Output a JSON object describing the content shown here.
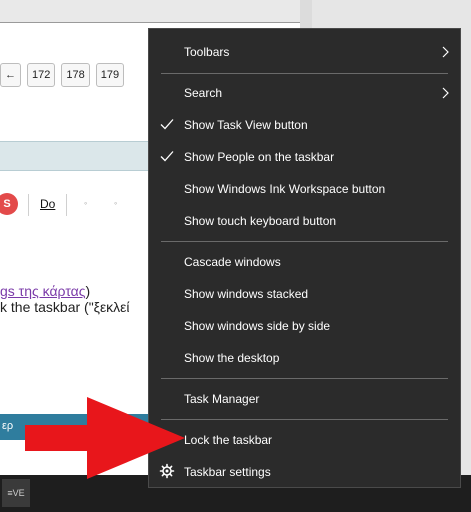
{
  "background": {
    "pager": [
      "←",
      "172",
      "178",
      "179"
    ],
    "badge_letter": "S",
    "underline_button": "Do",
    "line1": {
      "link": "gs της κάρτας",
      "suffix": ")"
    },
    "line2": "k the taskbar (\"ξεκλεί",
    "bluebar_text": "ερ"
  },
  "taskbar": {
    "app_label": "≡VE"
  },
  "context_menu": {
    "items": [
      {
        "label": "Toolbars",
        "checked": false,
        "submenu": true
      },
      {
        "label": "Search",
        "checked": false,
        "submenu": true
      },
      {
        "label": "Show Task View button",
        "checked": true,
        "submenu": false
      },
      {
        "label": "Show People on the taskbar",
        "checked": true,
        "submenu": false
      },
      {
        "label": "Show Windows Ink Workspace button",
        "checked": false,
        "submenu": false
      },
      {
        "label": "Show touch keyboard button",
        "checked": false,
        "submenu": false
      },
      {
        "label": "Cascade windows",
        "checked": false,
        "submenu": false
      },
      {
        "label": "Show windows stacked",
        "checked": false,
        "submenu": false
      },
      {
        "label": "Show windows side by side",
        "checked": false,
        "submenu": false
      },
      {
        "label": "Show the desktop",
        "checked": false,
        "submenu": false
      },
      {
        "label": "Task Manager",
        "checked": false,
        "submenu": false
      },
      {
        "label": "Lock the taskbar",
        "checked": true,
        "submenu": false
      },
      {
        "label": "Taskbar settings",
        "checked": false,
        "submenu": false,
        "icon": "gear-icon"
      }
    ]
  },
  "colors": {
    "menu_bg": "#2b2b2b",
    "menu_text": "#ffffff",
    "separator": "#6a6a6a",
    "arrow": "#e8161b"
  }
}
